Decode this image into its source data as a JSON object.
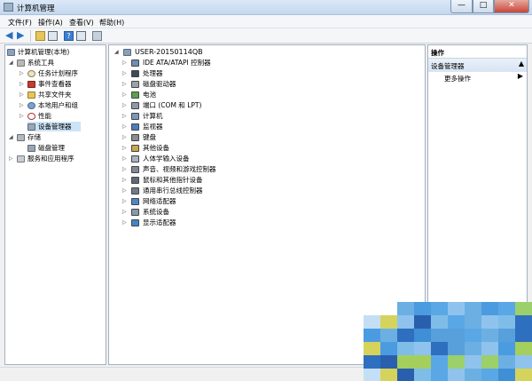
{
  "window": {
    "title": "计算机管理",
    "min": "—",
    "max": "□",
    "close": "✕"
  },
  "menu": [
    {
      "label": "文件(F)"
    },
    {
      "label": "操作(A)"
    },
    {
      "label": "查看(V)"
    },
    {
      "label": "帮助(H)"
    }
  ],
  "left_tree": {
    "root": "计算机管理(本地)",
    "items": [
      {
        "label": "系统工具",
        "icon": "tools-icon"
      },
      {
        "label": "任务计划程序",
        "icon": "clock-icon"
      },
      {
        "label": "事件查看器",
        "icon": "event-viewer-icon"
      },
      {
        "label": "共享文件夹",
        "icon": "shared-folder-icon"
      },
      {
        "label": "本地用户和组",
        "icon": "users-icon"
      },
      {
        "label": "性能",
        "icon": "performance-icon"
      },
      {
        "label": "设备管理器",
        "icon": "device-manager-icon"
      },
      {
        "label": "存储",
        "icon": "storage-icon"
      },
      {
        "label": "磁盘管理",
        "icon": "disk-icon"
      },
      {
        "label": "服务和应用程序",
        "icon": "services-icon"
      }
    ]
  },
  "device_tree": {
    "root": "USER-20150114QB",
    "categories": [
      {
        "label": "IDE ATA/ATAPI 控制器",
        "icon": "ide-controller-icon"
      },
      {
        "label": "处理器",
        "icon": "processor-icon"
      },
      {
        "label": "磁盘驱动器",
        "icon": "disk-drive-icon"
      },
      {
        "label": "电池",
        "icon": "battery-icon"
      },
      {
        "label": "端口 (COM 和 LPT)",
        "icon": "port-icon"
      },
      {
        "label": "计算机",
        "icon": "computer-icon"
      },
      {
        "label": "监视器",
        "icon": "monitor-icon"
      },
      {
        "label": "键盘",
        "icon": "keyboard-icon"
      },
      {
        "label": "其他设备",
        "icon": "other-devices-icon"
      },
      {
        "label": "人体学输入设备",
        "icon": "hid-icon"
      },
      {
        "label": "声音、视频和游戏控制器",
        "icon": "sound-icon"
      },
      {
        "label": "鼠标和其他指针设备",
        "icon": "mouse-icon"
      },
      {
        "label": "通用串行总线控制器",
        "icon": "usb-icon"
      },
      {
        "label": "网络适配器",
        "icon": "network-adapter-icon"
      },
      {
        "label": "系统设备",
        "icon": "system-devices-icon"
      },
      {
        "label": "显示适配器",
        "icon": "display-adapter-icon"
      }
    ]
  },
  "actions": {
    "header": "操作",
    "section": "设备管理器",
    "more": "更多操作"
  },
  "colors": {
    "selection": "#cce4f7",
    "pane_border": "#a3b1c2",
    "titlebar": "#c4d8ef"
  }
}
